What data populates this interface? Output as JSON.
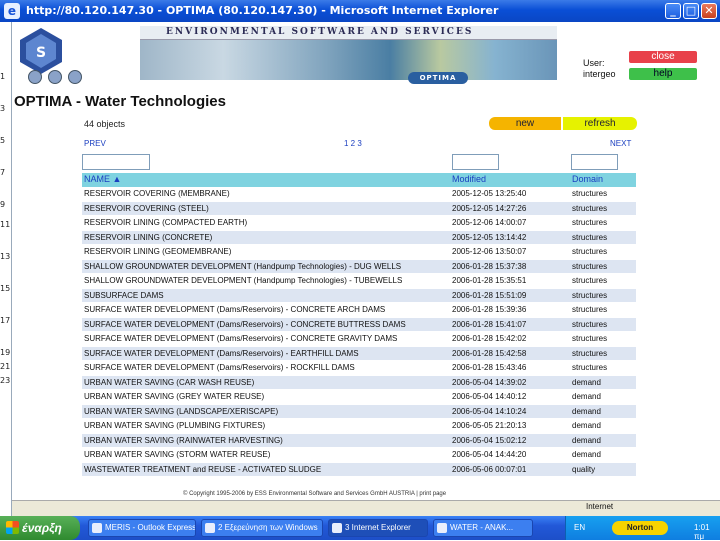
{
  "window": {
    "title": "http://80.120.147.30 - OPTIMA (80.120.147.30) - Microsoft Internet Explorer",
    "min": "_",
    "max": "□",
    "close": "✕"
  },
  "leftstrip": [
    "1",
    "3",
    "5",
    "7",
    "9",
    "11",
    "13",
    "15",
    "17",
    "19",
    "21",
    "23"
  ],
  "banner": {
    "text": "ENVIRONMENTAL SOFTWARE AND SERVICES",
    "badge": "OPTIMA"
  },
  "user": {
    "label": "User:",
    "name": "intergeo"
  },
  "buttons": {
    "close": "close",
    "help": "help",
    "new": "new",
    "refresh": "refresh"
  },
  "page": {
    "title": "OPTIMA - Water Technologies",
    "count": "44 objects",
    "prev": "PREV",
    "pages": "1 2 3",
    "next": "NEXT"
  },
  "table": {
    "headers": {
      "name": "NAME ▲",
      "modified": "Modified",
      "domain": "Domain"
    },
    "rows": [
      {
        "name": "RESERVOIR COVERING (MEMBRANE)",
        "modified": "2005-12-05 13:25:40",
        "domain": "structures"
      },
      {
        "name": "RESERVOIR COVERING (STEEL)",
        "modified": "2005-12-05 14:27:26",
        "domain": "structures"
      },
      {
        "name": "RESERVOIR LINING (COMPACTED EARTH)",
        "modified": "2005-12-06 14:00:07",
        "domain": "structures"
      },
      {
        "name": "RESERVOIR LINING (CONCRETE)",
        "modified": "2005-12-05 13:14:42",
        "domain": "structures"
      },
      {
        "name": "RESERVOIR LINING (GEOMEMBRANE)",
        "modified": "2005-12-06 13:50:07",
        "domain": "structures"
      },
      {
        "name": "SHALLOW GROUNDWATER DEVELOPMENT (Handpump Technologies) - DUG WELLS",
        "modified": "2006-01-28 15:37:38",
        "domain": "structures"
      },
      {
        "name": "SHALLOW GROUNDWATER DEVELOPMENT (Handpump Technologies) - TUBEWELLS",
        "modified": "2006-01-28 15:35:51",
        "domain": "structures"
      },
      {
        "name": "SUBSURFACE DAMS",
        "modified": "2006-01-28 15:51:09",
        "domain": "structures"
      },
      {
        "name": "SURFACE WATER DEVELOPMENT (Dams/Reservoirs) - CONCRETE ARCH DAMS",
        "modified": "2006-01-28 15:39:36",
        "domain": "structures"
      },
      {
        "name": "SURFACE WATER DEVELOPMENT (Dams/Reservoirs) - CONCRETE BUTTRESS DAMS",
        "modified": "2006-01-28 15:41:07",
        "domain": "structures"
      },
      {
        "name": "SURFACE WATER DEVELOPMENT (Dams/Reservoirs) - CONCRETE GRAVITY DAMS",
        "modified": "2006-01-28 15:42:02",
        "domain": "structures"
      },
      {
        "name": "SURFACE WATER DEVELOPMENT (Dams/Reservoirs) - EARTHFILL DAMS",
        "modified": "2006-01-28 15:42:58",
        "domain": "structures"
      },
      {
        "name": "SURFACE WATER DEVELOPMENT (Dams/Reservoirs) - ROCKFILL DAMS",
        "modified": "2006-01-28 15:43:46",
        "domain": "structures"
      },
      {
        "name": "URBAN WATER SAVING (CAR WASH REUSE)",
        "modified": "2006-05-04 14:39:02",
        "domain": "demand"
      },
      {
        "name": "URBAN WATER SAVING (GREY WATER REUSE)",
        "modified": "2006-05-04 14:40:12",
        "domain": "demand"
      },
      {
        "name": "URBAN WATER SAVING (LANDSCAPE/XERISCAPE)",
        "modified": "2006-05-04 14:10:24",
        "domain": "demand"
      },
      {
        "name": "URBAN WATER SAVING (PLUMBING FIXTURES)",
        "modified": "2006-05-05 21:20:13",
        "domain": "demand"
      },
      {
        "name": "URBAN WATER SAVING (RAINWATER HARVESTING)",
        "modified": "2006-05-04 15:02:12",
        "domain": "demand"
      },
      {
        "name": "URBAN WATER SAVING (STORM WATER REUSE)",
        "modified": "2006-05-04 14:44:20",
        "domain": "demand"
      },
      {
        "name": "WASTEWATER TREATMENT and REUSE - ACTIVATED SLUDGE",
        "modified": "2006-05-06 00:07:01",
        "domain": "quality"
      }
    ]
  },
  "footer": "© Copyright 1995-2006 by ESS Environmental Software and Services GmbH AUSTRIA | print page",
  "status": {
    "zone": "Internet"
  },
  "taskbar": {
    "start": "έναρξη",
    "tasks": [
      "MERIS - Outlook Express",
      "2 Εξερεύνηση των Windows",
      "3 Internet Explorer",
      "WATER - ANAK..."
    ],
    "lang": "EN",
    "norton": "Norton",
    "clock": "1:01 πμ"
  },
  "colors": {
    "titlebar": "#0a4fd6",
    "header_row": "#7fd3e0",
    "close": "#e8414a",
    "help": "#3ec04a",
    "new": "#f5b400",
    "refresh": "#e6f200"
  }
}
